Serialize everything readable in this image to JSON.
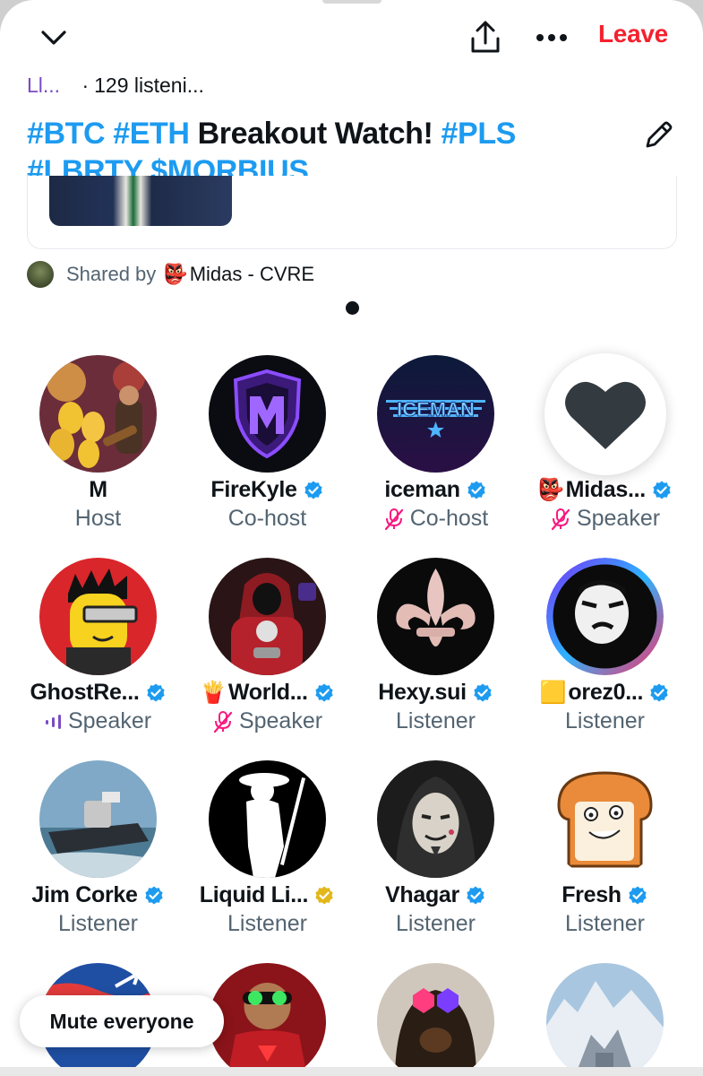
{
  "header": {
    "collapse_icon": "chevron-down-icon",
    "share_icon": "share-upload-icon",
    "more_icon": "more-horizontal-icon",
    "leave_label": "Leave"
  },
  "meta": {
    "label": "Ll...",
    "separator": "·",
    "listening": "129 listeni..."
  },
  "title": {
    "segments": [
      "#BTC",
      "#ETH",
      "Breakout Watch!",
      "#PLS",
      "#LBRTY",
      "$MORBIUS"
    ],
    "edit_icon": "pencil-icon"
  },
  "shared": {
    "prefix": "Shared by",
    "emoji": "👺",
    "name": "Midas - CVRE"
  },
  "participants": [
    {
      "name": "M",
      "role": "Host",
      "verified": false,
      "mic": "none"
    },
    {
      "name": "FireKyle",
      "role": "Co-host",
      "verified": true,
      "mic": "none"
    },
    {
      "name": "iceman",
      "role": "Co-host",
      "verified": true,
      "mic": "muted"
    },
    {
      "emoji": "👺",
      "name": "Midas...",
      "role": "Speaker",
      "verified": true,
      "mic": "muted",
      "reaction": "heart"
    },
    {
      "name": "GhostRe...",
      "role": "Speaker",
      "verified": true,
      "mic": "speaking"
    },
    {
      "emoji": "🍟",
      "name": "World...",
      "role": "Speaker",
      "verified": true,
      "mic": "muted"
    },
    {
      "name": "Hexy.sui",
      "role": "Listener",
      "verified": true,
      "mic": "none"
    },
    {
      "emoji": "🟨",
      "name": "orez0...",
      "role": "Listener",
      "verified": true,
      "mic": "none"
    },
    {
      "name": "Jim Corke",
      "role": "Listener",
      "verified": true,
      "mic": "none"
    },
    {
      "name": "Liquid Li...",
      "role": "Listener",
      "verified": "gold",
      "mic": "none"
    },
    {
      "name": "Vhagar",
      "role": "Listener",
      "verified": true,
      "mic": "none"
    },
    {
      "name": "Fresh",
      "role": "Listener",
      "verified": true,
      "mic": "none"
    }
  ],
  "avatar_logo_text": {
    "iceman": "ICEMAN"
  },
  "mute_everyone_label": "Mute everyone",
  "colors": {
    "accent_blue": "#1d9bf0",
    "leave_red": "#f4212e",
    "muted_pink": "#f91880",
    "speaker_purple": "#794bc4",
    "gold_badge": "#e2b719"
  }
}
